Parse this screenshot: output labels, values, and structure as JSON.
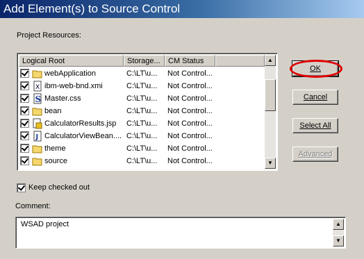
{
  "window": {
    "title": "Add Element(s) to Source Control"
  },
  "labels": {
    "project_resources": "Project Resources:",
    "keep_checked_out": "Keep checked out",
    "comment": "Comment:"
  },
  "table": {
    "columns": [
      "Logical Root",
      "Storage...",
      "CM Status",
      ""
    ],
    "rows": [
      {
        "checked": true,
        "icon": "folder-icon",
        "name": "webApplication",
        "storage": "C:\\LT\\u...",
        "status": "Not Control..."
      },
      {
        "checked": true,
        "icon": "xmi-file-icon",
        "name": "ibm-web-bnd.xmi",
        "storage": "C:\\LT\\u...",
        "status": "Not Control..."
      },
      {
        "checked": true,
        "icon": "css-file-icon",
        "name": "Master.css",
        "storage": "C:\\LT\\u...",
        "status": "Not Control..."
      },
      {
        "checked": true,
        "icon": "folder-icon",
        "name": "bean",
        "storage": "C:\\LT\\u...",
        "status": "Not Control..."
      },
      {
        "checked": true,
        "icon": "jsp-file-icon",
        "name": "CalculatorResults.jsp",
        "storage": "C:\\LT\\u...",
        "status": "Not Control..."
      },
      {
        "checked": true,
        "icon": "java-file-icon",
        "name": "CalculatorViewBean....",
        "storage": "C:\\LT\\u...",
        "status": "Not Control..."
      },
      {
        "checked": true,
        "icon": "folder-icon",
        "name": "theme",
        "storage": "C:\\LT\\u...",
        "status": "Not Control..."
      },
      {
        "checked": true,
        "icon": "folder-icon",
        "name": "source",
        "storage": "C:\\LT\\u...",
        "status": "Not Control..."
      }
    ]
  },
  "buttons": {
    "ok": "OK",
    "cancel": "Cancel",
    "select_all": "Select All",
    "advanced": "Advanced"
  },
  "keep_checked_out": true,
  "comment_value": "WSAD project",
  "colors": {
    "title_bar": "#0a246a",
    "highlight_oval": "#e00000",
    "dialog_bg": "#d4d0c8"
  }
}
